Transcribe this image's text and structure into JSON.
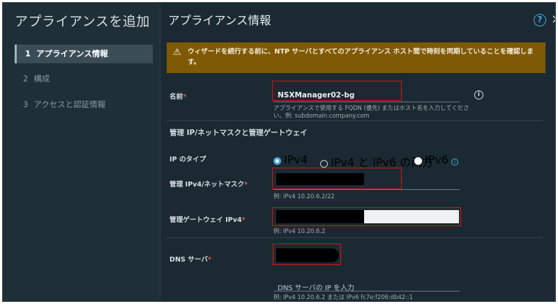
{
  "wizard": {
    "title": "アプライアンスを追加",
    "steps": [
      {
        "num": "1",
        "label": "アプライアンス情報"
      },
      {
        "num": "2",
        "label": "構成"
      },
      {
        "num": "3",
        "label": "アクセスと認証情報"
      }
    ]
  },
  "main": {
    "title": "アプライアンス情報",
    "help_glyph": "?",
    "close_glyph": "×",
    "warning": "ウィザードを続行する前に、NTP サーバとすべてのアプライアンス ホスト間で時刻を同期していることを確認します。",
    "name": {
      "label": "名前",
      "value": "NSXManager02-bg",
      "hint": "アプライアンスで使用する FQDN (優先) またはホスト名を入力してください。例: subdomain.company.com"
    },
    "section_title": "管理 IP/ネットマスクと管理ゲートウェイ",
    "ip_type": {
      "label": "IP のタイプ",
      "options": [
        "IPv4",
        "IPv4 と IPv6 の両方",
        "IPv6"
      ],
      "selected": "IPv4"
    },
    "mgmt_ipv4": {
      "label": "管理 IPv4/ネットマスク",
      "hint": "例: IPv4 10.20.6.2/22"
    },
    "gateway_ipv4": {
      "label": "管理ゲートウェイ IPv4",
      "hint": "例: IPv4 10.20.6.2"
    },
    "dns": {
      "label": "DNS サーバ",
      "placeholder": "DNS サーバの IP を入力",
      "hint": "例: IPv4 10.20.6.2 または IPv6 fc7e:f206:db42::1"
    }
  },
  "colors": {
    "background": "#1b2a32",
    "warning": "#7f5a06",
    "accent": "#49a7e4",
    "required": "#e05454",
    "annotation": "#e01010"
  }
}
